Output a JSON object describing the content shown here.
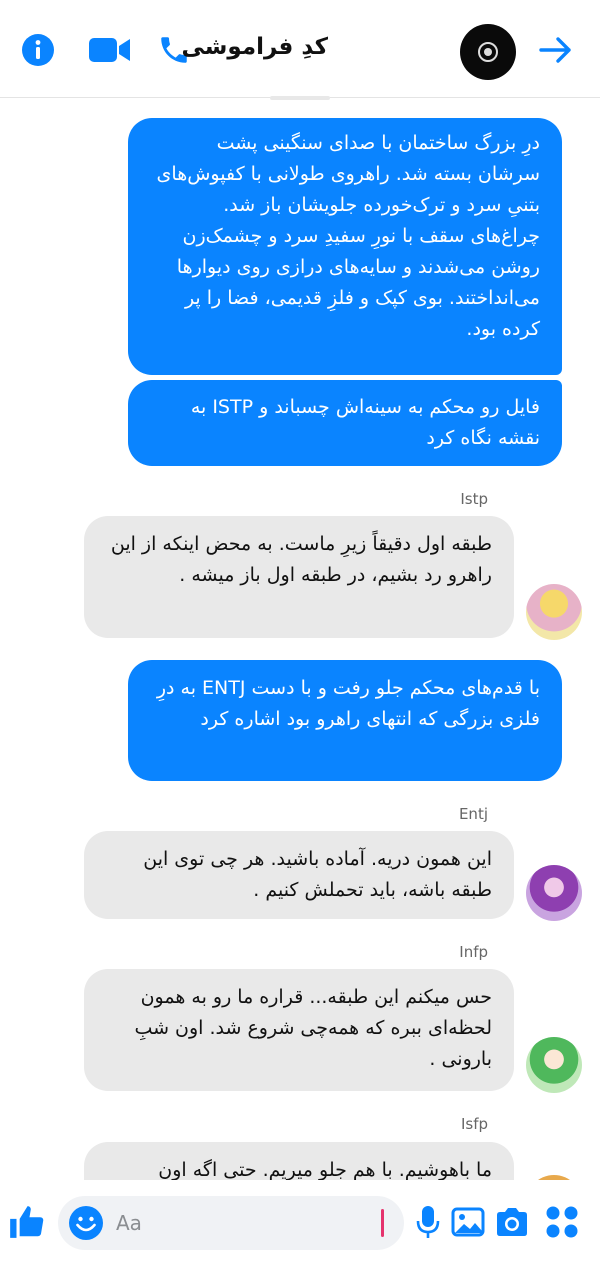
{
  "header": {
    "contact_name": "کدِ فراموشی",
    "info_icon": "info-icon",
    "video_icon": "video-camera-icon",
    "call_icon": "phone-icon",
    "back_icon": "arrow-right-icon"
  },
  "messages": [
    {
      "direction": "outgoing",
      "text": "درِ بزرگ ساختمان با صدای سنگینی پشت سرشان بسته شد. راهروی طولانی با کفپوش‌های بتنیِ سرد و ترک‌خورده جلویشان باز شد. چراغ‌های سقف با نورِ سفیدِ سرد و چشمک‌زن روشن می‌شدند و سایه‌های درازی روی دیوارها می‌انداختند. بوی کپک و فلزِ قدیمی، فضا را پر کرده بود."
    },
    {
      "direction": "outgoing",
      "text": "فایل رو محکم به سینه‌اش چسباند و ISTP به نقشه نگاه کرد"
    },
    {
      "direction": "incoming",
      "sender": "Istp",
      "text": "طبقه اول دقیقاً زیرِ ماست. به محض اینکه از این راهرو رد بشیم، در طبقه اول باز میشه ."
    },
    {
      "direction": "outgoing",
      "text": "با قدم‌های محکم جلو رفت و با دست ENTJ به درِ فلزی بزرگی که انتهای راهرو بود اشاره کرد"
    },
    {
      "direction": "incoming",
      "sender": "Entj",
      "text": "این همون دریه. آماده باشید. هر چی توی این طبقه باشه، باید تحملش کنیم ."
    },
    {
      "direction": "incoming",
      "sender": "Infp",
      "text": "حس میکنم این طبقه... قراره ما رو به همون لحظه‌ای ببره که همه‌چی شروع شد. اون شبِ بارونی ."
    },
    {
      "direction": "incoming",
      "sender": "Isfp",
      "text": "ما باهوشیم. با هم جلو میریم. حتی اگه اون"
    }
  ],
  "composer": {
    "placeholder": "Aa",
    "like_icon": "thumbs-up-icon",
    "emoji_icon": "emoji-icon",
    "mic_icon": "microphone-icon",
    "gallery_icon": "image-gallery-icon",
    "camera_icon": "camera-icon",
    "apps_icon": "apps-grid-icon"
  },
  "colors": {
    "accent": "#0a84ff",
    "incoming_bubble": "#e9e9e9",
    "caret": "#e5336d"
  }
}
